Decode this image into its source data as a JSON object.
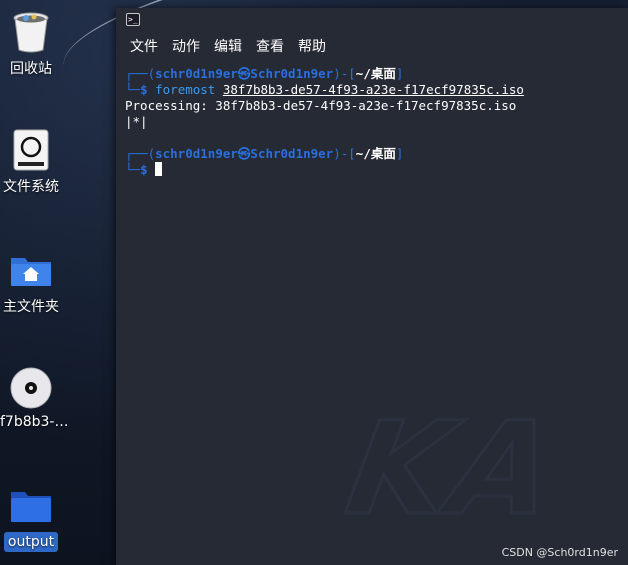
{
  "desktop": {
    "icons": [
      {
        "label": "回收站",
        "icon": "trash-icon"
      },
      {
        "label": "文件系统",
        "icon": "drive-icon"
      },
      {
        "label": "主文件夹",
        "icon": "home-folder-icon"
      },
      {
        "label": "f7b8b3-…",
        "icon": "disc-icon"
      },
      {
        "label": "output",
        "icon": "folder-icon"
      }
    ]
  },
  "terminal": {
    "menu": [
      "文件",
      "动作",
      "编辑",
      "查看",
      "帮助"
    ],
    "prompt_user": "schr0d1n9er",
    "prompt_at": "㉿",
    "prompt_host": "Schr0d1n9er",
    "prompt_dir": "~/桌面",
    "command": "foremost",
    "argument": "38f7b8b3-de57-4f93-a23e-f17ecf97835c.iso",
    "output_1": "Processing: 38f7b8b3-de57-4f93-a23e-f17ecf97835c.iso",
    "output_2": "|*|",
    "watermark": "KA"
  },
  "credit": "CSDN @Sch0rd1n9er",
  "colors": {
    "prompt_blue": "#2a6fdb",
    "command_blue": "#3a9bf0",
    "terminal_bg": "#252a34",
    "selection": "#2f69c7"
  }
}
